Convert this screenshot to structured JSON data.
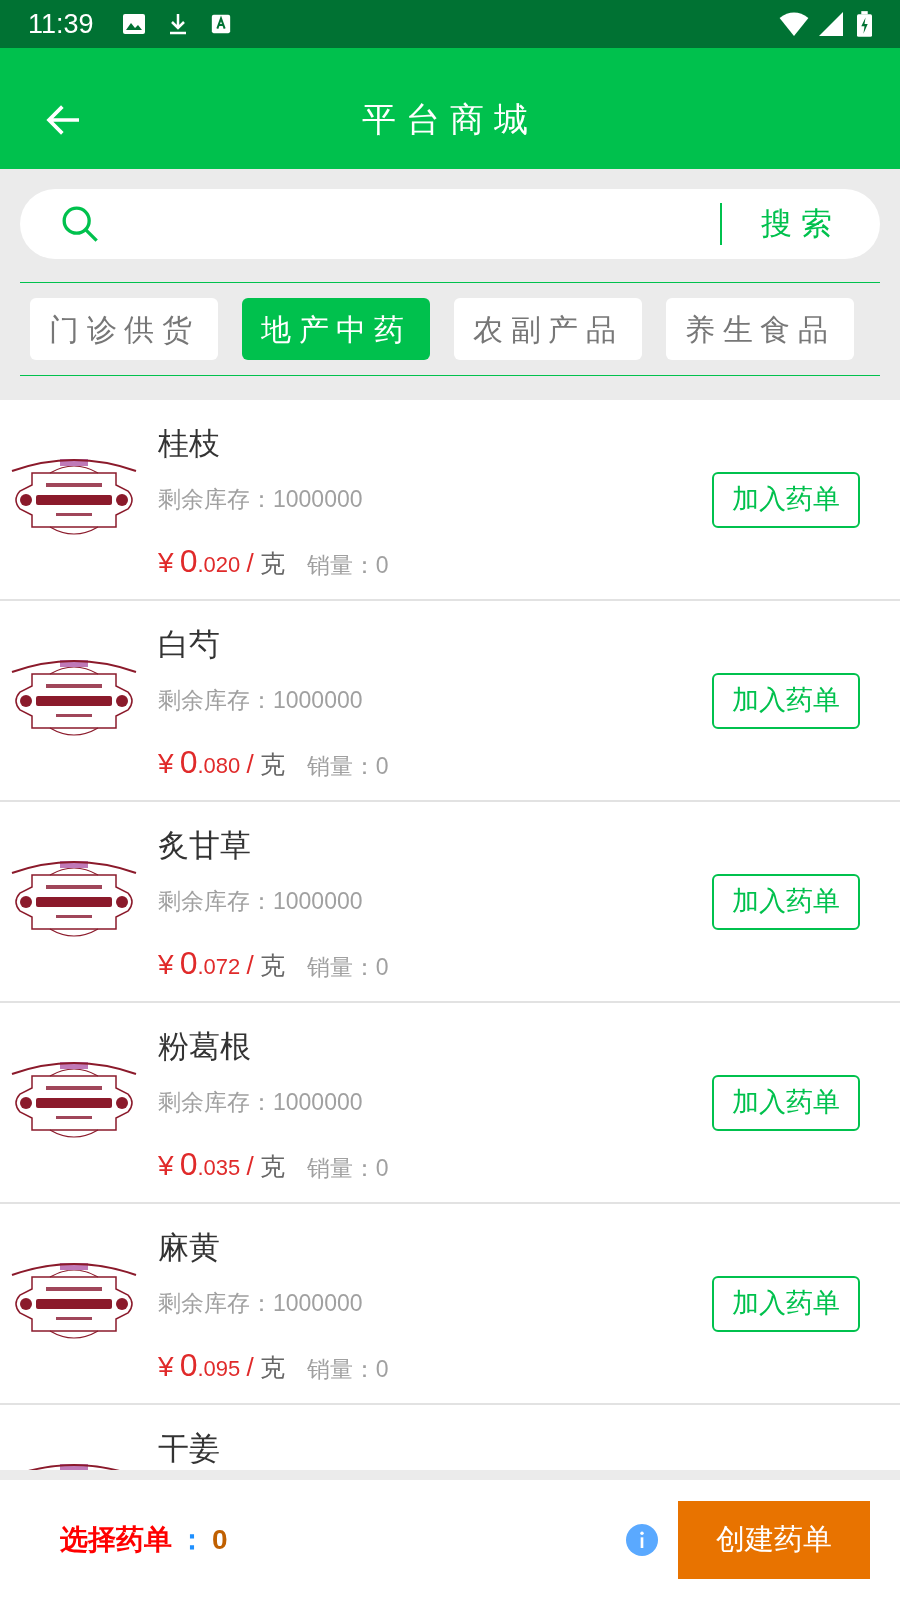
{
  "status_bar": {
    "time": "11:39"
  },
  "header": {
    "title": "平台商城"
  },
  "search": {
    "button": "搜索"
  },
  "tabs": [
    {
      "label": "门诊供货",
      "selected": false
    },
    {
      "label": "地产中药",
      "selected": true
    },
    {
      "label": "农副产品",
      "selected": false
    },
    {
      "label": "养生食品",
      "selected": false
    }
  ],
  "products": [
    {
      "name": "桂枝",
      "stock": "剩余库存：1000000",
      "price": {
        "currency": "¥",
        "whole": "0",
        "fraction": ".020",
        "separator": "/",
        "unit": "克"
      },
      "sales": "销量：0",
      "button": "加入药单"
    },
    {
      "name": "白芍",
      "stock": "剩余库存：1000000",
      "price": {
        "currency": "¥",
        "whole": "0",
        "fraction": ".080",
        "separator": "/",
        "unit": "克"
      },
      "sales": "销量：0",
      "button": "加入药单"
    },
    {
      "name": "炙甘草",
      "stock": "剩余库存：1000000",
      "price": {
        "currency": "¥",
        "whole": "0",
        "fraction": ".072",
        "separator": "/",
        "unit": "克"
      },
      "sales": "销量：0",
      "button": "加入药单"
    },
    {
      "name": "粉葛根",
      "stock": "剩余库存：1000000",
      "price": {
        "currency": "¥",
        "whole": "0",
        "fraction": ".035",
        "separator": "/",
        "unit": "克"
      },
      "sales": "销量：0",
      "button": "加入药单"
    },
    {
      "name": "麻黄",
      "stock": "剩余库存：1000000",
      "price": {
        "currency": "¥",
        "whole": "0",
        "fraction": ".095",
        "separator": "/",
        "unit": "克"
      },
      "sales": "销量：0",
      "button": "加入药单"
    },
    {
      "name": "干姜"
    }
  ],
  "footer": {
    "label": "选择药单",
    "colon": "：",
    "count": "0",
    "button": "创建药单"
  }
}
